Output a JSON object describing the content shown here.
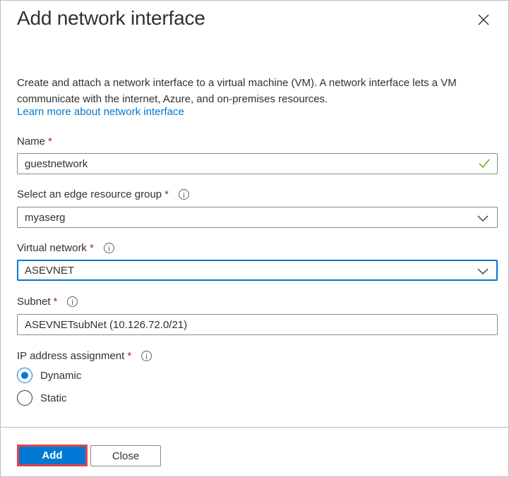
{
  "dialog": {
    "title": "Add network interface",
    "close_icon": "close-icon"
  },
  "description": {
    "text": "Create and attach a network interface to a virtual machine (VM). A network interface lets a VM communicate with the internet, Azure, and on-premises resources.",
    "link_label": "Learn more about network interface"
  },
  "form": {
    "name": {
      "label": "Name",
      "required_mark": "*",
      "value": "guestnetwork",
      "status_icon": "check-icon",
      "status_color": "#57a300"
    },
    "resource_group": {
      "label": "Select an edge resource group",
      "required_mark": "*",
      "info_icon": "info-icon",
      "value": "myaserg"
    },
    "virtual_network": {
      "label": "Virtual network",
      "required_mark": "*",
      "info_icon": "info-icon",
      "value": "ASEVNET",
      "focused": true
    },
    "subnet": {
      "label": "Subnet",
      "required_mark": "*",
      "info_icon": "info-icon",
      "value": "ASEVNETsubNet (10.126.72.0/21)"
    },
    "ip_assignment": {
      "label": "IP address assignment",
      "required_mark": "*",
      "info_icon": "info-icon",
      "options": [
        {
          "label": "Dynamic",
          "selected": true
        },
        {
          "label": "Static",
          "selected": false
        }
      ]
    }
  },
  "footer": {
    "add_label": "Add",
    "close_label": "Close"
  },
  "colors": {
    "accent": "#0078d4",
    "required": "#a4262c",
    "highlight_border": "#e8424a",
    "text": "#323130"
  }
}
